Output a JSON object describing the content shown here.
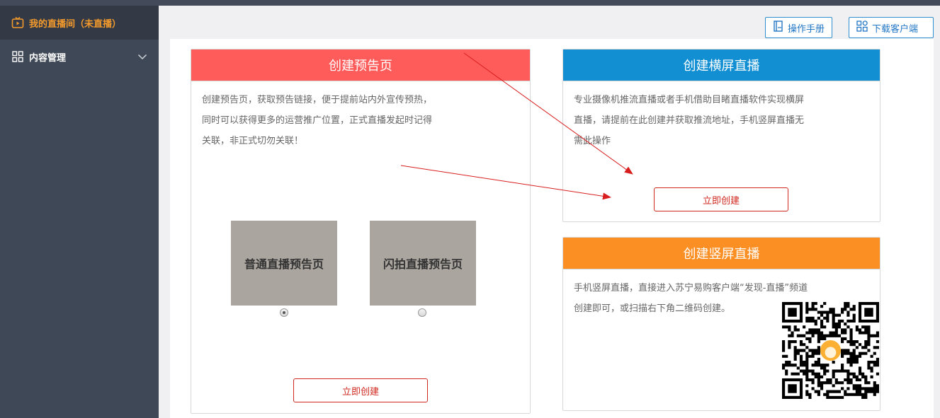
{
  "sidebar": {
    "items": [
      {
        "label": "我的直播间（未直播）",
        "icon": "tv-icon",
        "active": true
      },
      {
        "label": "内容管理",
        "icon": "grid-icon",
        "active": false
      }
    ]
  },
  "header": {
    "manual_label": "操作手册",
    "download_label": "下载客户端"
  },
  "cards": {
    "preview": {
      "title": "创建预告页",
      "desc": [
        "创建预告页，获取预告链接，便于提前站内外宣传预热，",
        "同时可以获得更多的运营推广位置，正式直播发起时记得",
        "关联，非正式切勿关联！"
      ],
      "templates": [
        {
          "label": "普通直播预告页",
          "selected": true
        },
        {
          "label": "闪拍直播预告页",
          "selected": false
        }
      ],
      "button": "立即创建"
    },
    "landscape": {
      "title": "创建横屏直播",
      "desc": [
        "专业摄像机推流直播或者手机借助目睹直播软件实现横屏",
        "直播，请提前在此创建并获取推流地址，手机竖屏直播无",
        "需此操作"
      ],
      "button": "立即创建"
    },
    "portrait": {
      "title": "创建竖屏直播",
      "desc": [
        "手机竖屏直播，直接进入苏宁易购客户端“发现-直播”频道",
        "创建即可，或扫描右下角二维码创建。"
      ],
      "qr_icon": "qr-code"
    }
  },
  "colors": {
    "preview_head": "#fe5c5a",
    "landscape_head": "#118fd2",
    "portrait_head": "#fb8f23",
    "accent": "#d0281f",
    "sidebar_active": "#f49a2c"
  }
}
